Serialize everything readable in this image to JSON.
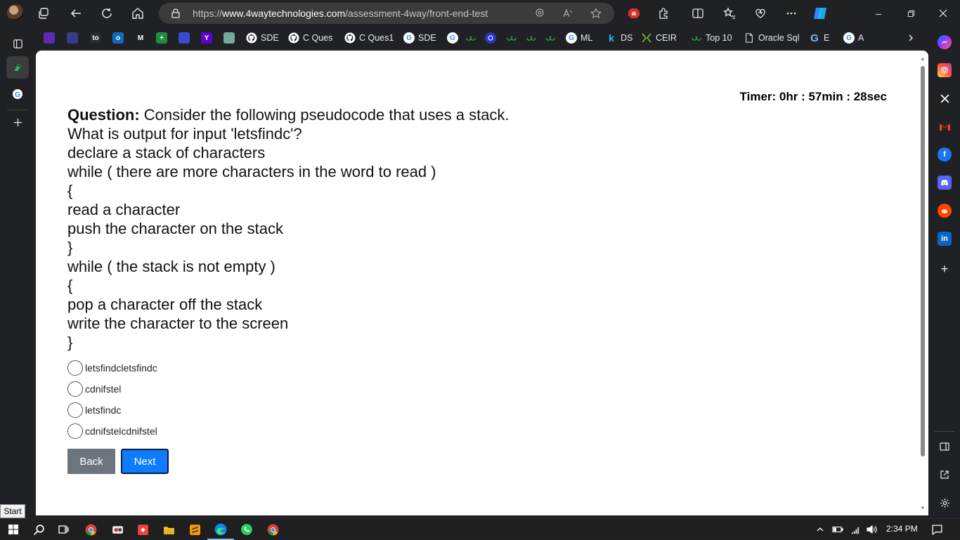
{
  "browser": {
    "url_prefix": "https://",
    "url_domain": "www.4waytechnologies.com",
    "url_path": "/assessment-4way/front-end-test"
  },
  "favorites": [
    {
      "label": "",
      "icon": "purple-app-icon",
      "color": "#5b2bb5"
    },
    {
      "label": "",
      "icon": "compass-icon",
      "color": "#3a3a8a"
    },
    {
      "label": "",
      "icon": "tofu-icon",
      "color": "#2a2a2a",
      "glyph": "to"
    },
    {
      "label": "",
      "icon": "outlook-icon",
      "color": "#0f6cbd",
      "glyph": "o"
    },
    {
      "label": "",
      "icon": "gmail-icon",
      "color": "#202124",
      "glyph": "M"
    },
    {
      "label": "",
      "icon": "sheets-plus-icon",
      "color": "#1e8e3e",
      "glyph": "+"
    },
    {
      "label": "",
      "icon": "link-icon",
      "color": "#3b4bd1"
    },
    {
      "label": "",
      "icon": "yahoo-icon",
      "color": "#5f01d1",
      "glyph": "Y"
    },
    {
      "label": "",
      "icon": "chatgpt-icon",
      "color": "#74aa9c"
    },
    {
      "label": "SDE",
      "icon": "github-icon",
      "color": "#ffffff"
    },
    {
      "label": "C Ques",
      "icon": "github-icon",
      "color": "#ffffff"
    },
    {
      "label": "C Ques1",
      "icon": "github-icon",
      "color": "#ffffff"
    },
    {
      "label": "SDE",
      "icon": "google-icon",
      "color": "#ffffff",
      "glyph": "G"
    },
    {
      "label": "",
      "icon": "google-icon",
      "color": "#ffffff",
      "glyph": "G"
    },
    {
      "label": "",
      "icon": "geeks-icon",
      "color": "#2f8d46"
    },
    {
      "label": "",
      "icon": "circle-icon",
      "color": "#2a34c9"
    },
    {
      "label": "",
      "icon": "geeks-icon",
      "color": "#2f8d46"
    },
    {
      "label": "",
      "icon": "gfg-icon",
      "color": "#2f8d46"
    },
    {
      "label": "",
      "icon": "geeks-icon",
      "color": "#2f8d46"
    },
    {
      "label": "ML",
      "icon": "google-icon",
      "color": "#ffffff",
      "glyph": "G"
    },
    {
      "label": "DS",
      "icon": "k-icon",
      "color": "#202124",
      "glyph": "k"
    },
    {
      "label": "CEIR",
      "icon": "ceir-icon",
      "color": "#202124"
    },
    {
      "label": "Top 10",
      "icon": "gfg-icon",
      "color": "#2f8d46"
    },
    {
      "label": "Oracle Sql",
      "icon": "page-icon",
      "color": "#202124"
    },
    {
      "label": "E",
      "icon": "google-g-icon",
      "color": "#202124",
      "glyph": "G"
    },
    {
      "label": "A",
      "icon": "google-icon",
      "color": "#ffffff",
      "glyph": "G"
    }
  ],
  "page": {
    "timer": "Timer: 0hr : 57min : 28sec",
    "question_label": "Question:",
    "question_lines": [
      " Consider the following pseudocode that uses a stack.",
      "What is output for input 'letsfindc'?",
      "declare a stack of characters",
      "while ( there are more characters in the word to read )",
      "{",
      "read a character",
      "push the character on the stack",
      "}",
      "while ( the stack is not empty )",
      "{",
      "pop a character off the stack",
      "write the character to the screen",
      "}"
    ],
    "options": [
      "letsfindcletsfindc",
      "cdnifstel",
      "letsfindc",
      "cdnifstelcdnifstel"
    ],
    "back_label": "Back",
    "next_label": "Next"
  },
  "taskbar": {
    "time": "2:34 PM",
    "start_tooltip": "Start"
  }
}
